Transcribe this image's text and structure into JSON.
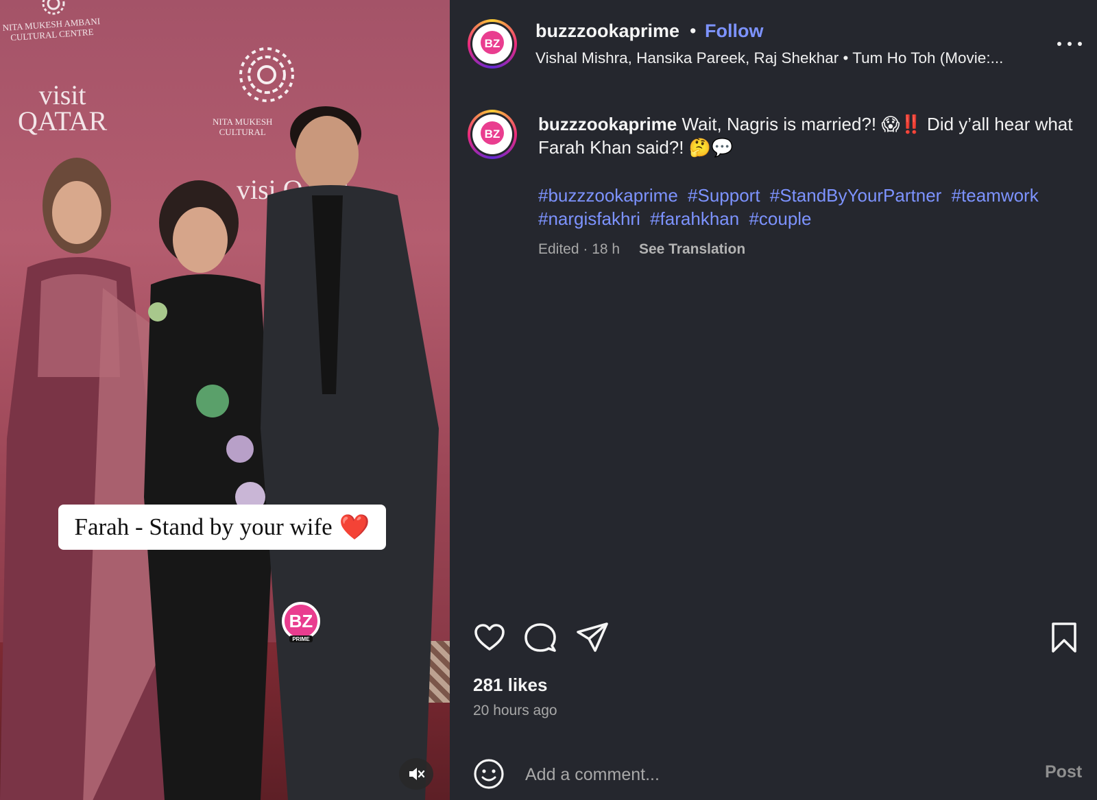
{
  "media": {
    "backdrop": {
      "nmacc_line1": "NITA MUKESH AMBANI",
      "nmacc_line2": "CULTURAL CENTRE",
      "qatar_line1": "visit",
      "qatar_line2": "QATAR",
      "nmacc2_line1": "NITA MUKESH",
      "nmacc2_line2": "CULTURAL",
      "qatar2": "visi QATA"
    },
    "overlay_caption": "Farah - Stand by your wife",
    "overlay_emoji": "❤️",
    "watermark_text": "BZ",
    "watermark_sub": "PRIME",
    "mute_icon": "speaker-muted-icon"
  },
  "header": {
    "username": "buzzzookaprime",
    "separator": "•",
    "follow_label": "Follow",
    "audio": "Vishal Mishra, Hansika Pareek, Raj Shekhar • Tum Ho Toh (Movie:...",
    "avatar_text": "BZ",
    "more_icon": "more-options-icon"
  },
  "caption": {
    "username": "buzzzookaprime",
    "text": "Wait, Nagris is married?! 😱‼️ Did y’all hear what Farah Khan said?! 🤔💬",
    "hashtags": [
      "#buzzzookaprime",
      "#Support",
      "#StandByYourPartner",
      "#teamwork",
      "#nargisfakhri",
      "#farahkhan",
      "#couple"
    ],
    "edited": "Edited · 18 h",
    "see_translation": "See Translation"
  },
  "actions": {
    "like_icon": "heart-icon",
    "comment_icon": "comment-icon",
    "share_icon": "share-icon",
    "save_icon": "bookmark-icon"
  },
  "stats": {
    "likes": "281 likes",
    "time_ago": "20 hours ago"
  },
  "comment_box": {
    "emoji_icon": "smiley-icon",
    "placeholder": "Add a comment...",
    "post_label": "Post"
  },
  "colors": {
    "background": "#25272e",
    "link_blue": "#7d93ff",
    "muted_text": "#a8a8a8"
  }
}
